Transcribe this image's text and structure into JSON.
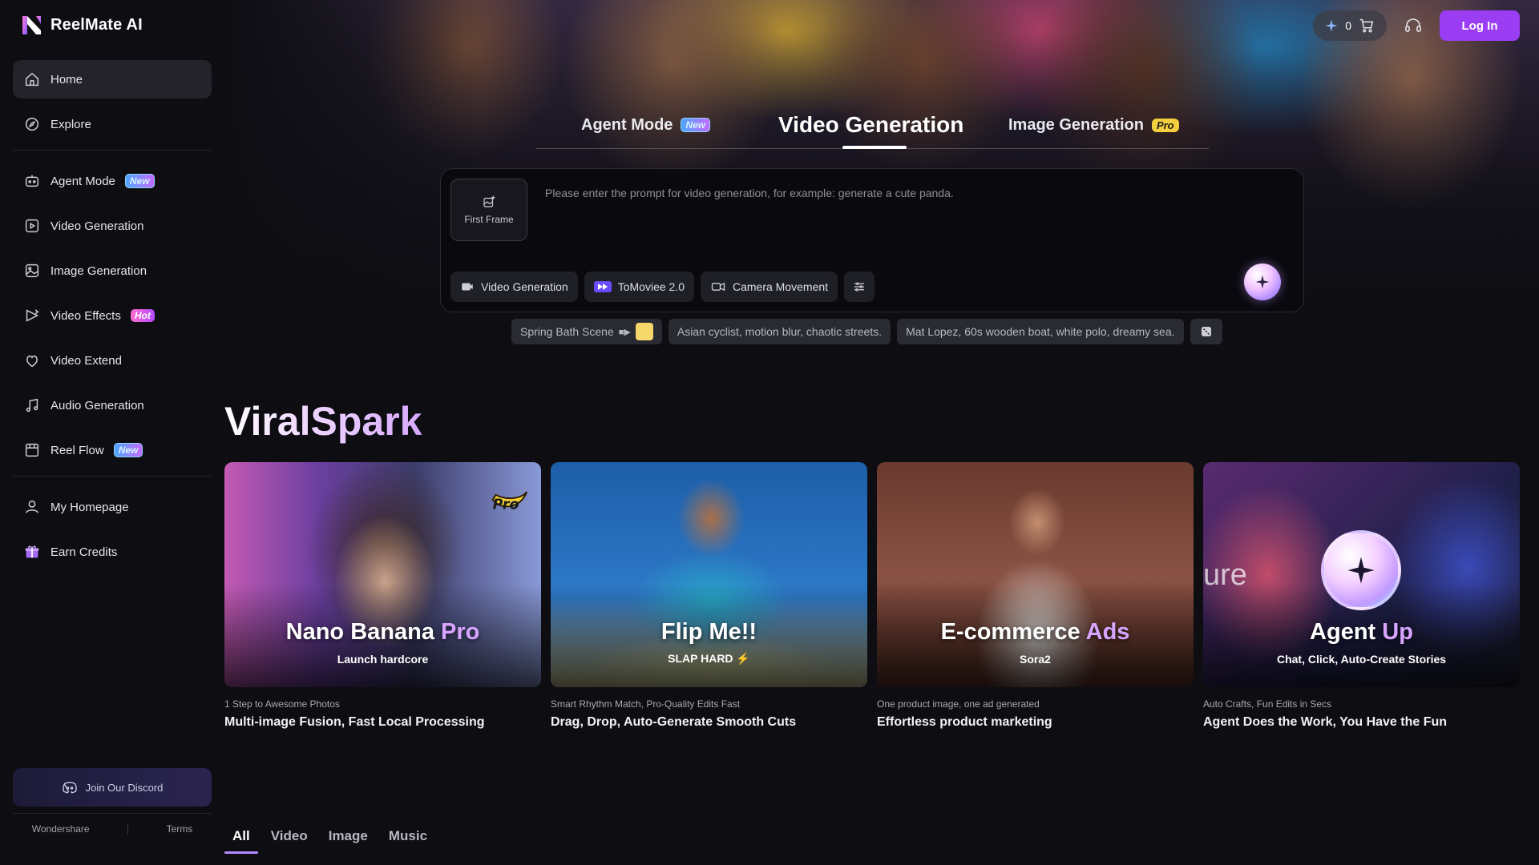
{
  "app": {
    "name": "ReelMate AI"
  },
  "sidebar": {
    "items": [
      {
        "label": "Home",
        "icon": "home-icon"
      },
      {
        "label": "Explore",
        "icon": "compass-icon"
      },
      {
        "label": "Agent Mode",
        "icon": "robot-icon",
        "tag": "New"
      },
      {
        "label": "Video Generation",
        "icon": "video-icon"
      },
      {
        "label": "Image Generation",
        "icon": "image-icon"
      },
      {
        "label": "Video Effects",
        "icon": "video-effects-icon",
        "tag": "Hot"
      },
      {
        "label": "Video Extend",
        "icon": "extend-icon"
      },
      {
        "label": "Audio Generation",
        "icon": "music-icon"
      },
      {
        "label": "Reel Flow",
        "icon": "reel-flow-icon",
        "tag": "New"
      },
      {
        "label": "My Homepage",
        "icon": "user-icon"
      },
      {
        "label": "Earn Credits",
        "icon": "gift-icon"
      }
    ],
    "discord": "Join Our Discord",
    "footer": [
      "Wondershare",
      "Terms"
    ]
  },
  "topbar": {
    "credits": "0",
    "login": "Log In"
  },
  "mode_tabs": [
    {
      "label": "Agent Mode",
      "tag": "New"
    },
    {
      "label": "Video Generation"
    },
    {
      "label": "Image Generation",
      "tag": "Pro"
    }
  ],
  "prompt": {
    "first_frame": "First Frame",
    "placeholder": "Please enter the prompt for video generation, for example: generate a cute panda.",
    "chips": [
      "Video Generation",
      "ToMoviee 2.0",
      "Camera Movement"
    ]
  },
  "suggestions": [
    "Spring Bath Scene",
    "Asian cyclist, motion blur, chaotic streets.",
    "Mat Lopez, 60s wooden boat, white polo, dreamy sea."
  ],
  "section": {
    "title": "ViralSpark",
    "cards": [
      {
        "title_main": "Nano Banana ",
        "title_hl": "Pro",
        "sub": "Launch hardcore",
        "small": "1 Step to Awesome Photos",
        "desc": "Multi-image Fusion, Fast Local Processing"
      },
      {
        "title_main": "Flip Me!!",
        "title_hl": "",
        "sub": "SLAP HARD ⚡",
        "small": "Smart Rhythm Match, Pro-Quality Edits Fast",
        "desc": "Drag, Drop, Auto-Generate Smooth Cuts"
      },
      {
        "title_main": "E-commerce ",
        "title_hl": "Ads",
        "sub": "Sora2",
        "small": "One product image, one ad generated",
        "desc": "Effortless product marketing"
      },
      {
        "title_main": "Agent ",
        "title_hl": "Up",
        "sub": "Chat, Click, Auto-Create Stories",
        "small": "Auto Crafts, Fun Edits in Secs",
        "desc": "Agent Does the Work, You Have the Fun",
        "bg_text": "ure"
      }
    ]
  },
  "bottom_tabs": [
    "All",
    "Video",
    "Image",
    "Music"
  ]
}
